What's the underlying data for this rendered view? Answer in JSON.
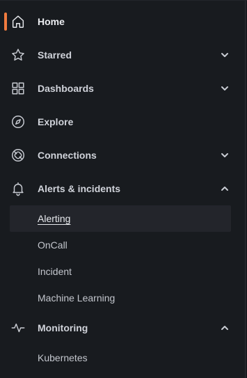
{
  "nav": {
    "home": {
      "label": "Home",
      "icon": "home-icon",
      "active": true
    },
    "starred": {
      "label": "Starred",
      "icon": "star-icon",
      "expanded": false
    },
    "dashboards": {
      "label": "Dashboards",
      "icon": "dashboards-grid-icon",
      "expanded": false
    },
    "explore": {
      "label": "Explore",
      "icon": "compass-icon"
    },
    "connections": {
      "label": "Connections",
      "icon": "connections-icon",
      "expanded": false
    },
    "alerts": {
      "label": "Alerts & incidents",
      "icon": "bell-icon",
      "expanded": true,
      "children": [
        {
          "label": "Alerting",
          "selected": true
        },
        {
          "label": "OnCall"
        },
        {
          "label": "Incident"
        },
        {
          "label": "Machine Learning"
        }
      ]
    },
    "monitoring": {
      "label": "Monitoring",
      "icon": "heartbeat-icon",
      "expanded": true,
      "children": [
        {
          "label": "Kubernetes"
        }
      ]
    }
  },
  "colors": {
    "active_indicator": "#f07b3f",
    "background": "#181b1f",
    "selected_background": "#23252b"
  }
}
